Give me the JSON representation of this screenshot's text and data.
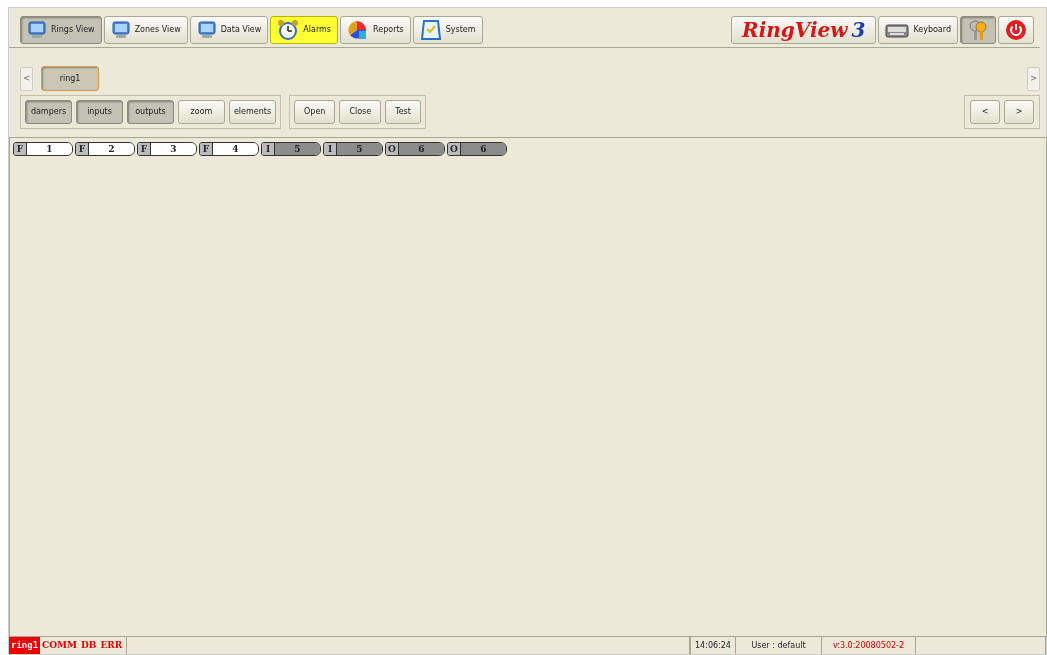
{
  "nav_buttons": [
    {
      "label": "Rings View",
      "kind": "monitor",
      "selected": true,
      "highlighted": false
    },
    {
      "label": "Zones View",
      "kind": "monitor",
      "selected": false,
      "highlighted": false
    },
    {
      "label": "Data View",
      "kind": "monitor",
      "selected": false,
      "highlighted": false
    },
    {
      "label": "Alarms",
      "kind": "clock",
      "selected": false,
      "highlighted": true
    },
    {
      "label": "Reports",
      "kind": "chart",
      "selected": false,
      "highlighted": false
    },
    {
      "label": "System",
      "kind": "check",
      "selected": false,
      "highlighted": false
    }
  ],
  "logo": {
    "name": "RingView",
    "version": "3"
  },
  "keyboard_button": {
    "label": "Keyboard"
  },
  "keys_button": {
    "selected": true
  },
  "ring_tabs": {
    "prev": "<",
    "next": ">",
    "tabs": [
      {
        "label": "ring1",
        "selected": true
      }
    ]
  },
  "filters": [
    {
      "label": "dampers",
      "selected": true
    },
    {
      "label": "inputs",
      "selected": true
    },
    {
      "label": "outputs",
      "selected": true
    },
    {
      "label": "zoom",
      "selected": false
    },
    {
      "label": "elements",
      "selected": false
    }
  ],
  "actions": [
    "Open",
    "Close",
    "Test"
  ],
  "pager": [
    "<",
    ">"
  ],
  "elements": [
    {
      "type": "F",
      "number": "1",
      "active": false
    },
    {
      "type": "F",
      "number": "2",
      "active": false
    },
    {
      "type": "F",
      "number": "3",
      "active": false
    },
    {
      "type": "F",
      "number": "4",
      "active": false
    },
    {
      "type": "I",
      "number": "5",
      "active": true
    },
    {
      "type": "I",
      "number": "5",
      "active": true
    },
    {
      "type": "O",
      "number": "6",
      "active": true
    },
    {
      "type": "O",
      "number": "6",
      "active": true
    }
  ],
  "status_bar": {
    "indicators": [
      {
        "label": "ring1",
        "on": true
      },
      {
        "label": "COMM",
        "on": false
      },
      {
        "label": "DB",
        "on": false
      },
      {
        "label": "ERR",
        "on": false
      }
    ],
    "time": "14:06:24",
    "user": "User : default",
    "version": "v:3.0:20080502-2"
  }
}
